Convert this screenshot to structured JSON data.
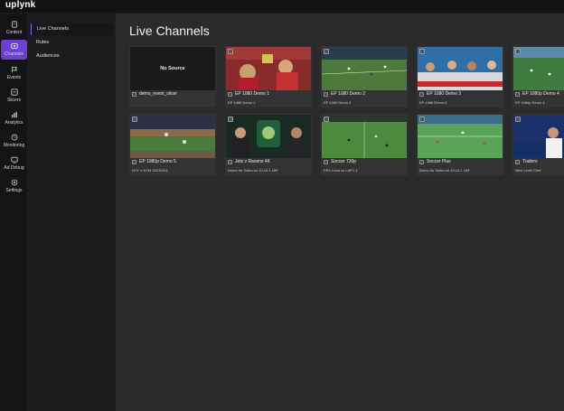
{
  "app": {
    "logo": "uplynk"
  },
  "rail": [
    {
      "label": "Content",
      "icon": "content-icon",
      "active": false
    },
    {
      "label": "Channels",
      "icon": "channels-icon",
      "active": true
    },
    {
      "label": "Events",
      "icon": "events-icon",
      "active": false
    },
    {
      "label": "Slicers",
      "icon": "slicers-icon",
      "active": false
    },
    {
      "label": "Analytics",
      "icon": "analytics-icon",
      "active": false
    },
    {
      "label": "Monitoring",
      "icon": "monitoring-icon",
      "active": false
    },
    {
      "label": "Ad Debug",
      "icon": "ad-debug-icon",
      "active": false
    },
    {
      "label": "Settings",
      "icon": "settings-icon",
      "active": false
    }
  ],
  "subnav": [
    {
      "label": "Live Channels",
      "active": true
    },
    {
      "label": "Rules",
      "active": false
    },
    {
      "label": "Audiences",
      "active": false
    }
  ],
  "main": {
    "title": "Live Channels",
    "cards": [
      {
        "name": "demo_event_slicer",
        "subtitle": "",
        "no_source": "No Source",
        "scene": "empty"
      },
      {
        "name": "EP 1080 Demo 1",
        "subtitle": "EP 1080 Demo 1",
        "scene": "football-crowd"
      },
      {
        "name": "EP 1080 Demo 2",
        "subtitle": "EP 1080 Demo 2",
        "scene": "soccer-wide"
      },
      {
        "name": "EP 1080 Demo 3",
        "subtitle": "EP 1080 Demo 3",
        "scene": "studio"
      },
      {
        "name": "EP 1080p Demo 4",
        "subtitle": "EP 1080p Demo 4",
        "scene": "soccer-green"
      },
      {
        "name": "EP 1080p Demo 5",
        "subtitle": "NYY v NYM 20210911",
        "scene": "baseball"
      },
      {
        "name": "Jets v Ravens 4K",
        "subtitle": "Demo for Sales on 10.10.1.159",
        "scene": "nfl-studio"
      },
      {
        "name": "Soccer 720p",
        "subtitle": "PSV Leon vs LAFC 1",
        "scene": "soccer-field"
      },
      {
        "name": "Soccer Plus",
        "subtitle": "Demo for Sales on 10.10.1.159",
        "scene": "soccer-field2"
      },
      {
        "name": "Trailers",
        "subtitle": "Next Level Chef",
        "scene": "trailer"
      }
    ]
  }
}
